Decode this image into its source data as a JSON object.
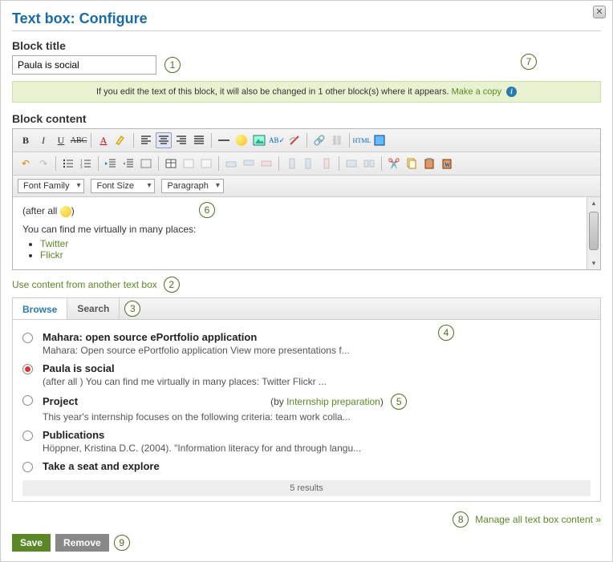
{
  "dialog": {
    "title": "Text box: Configure"
  },
  "block_title": {
    "label": "Block title",
    "value": "Paula is social"
  },
  "notice": {
    "text": "If you edit the text of this block, it will also be changed in 1 other block(s) where it appears.",
    "link": "Make a copy"
  },
  "block_content": {
    "label": "Block content"
  },
  "toolbar": {
    "font_family": "Font Family",
    "font_size": "Font Size",
    "paragraph": "Paragraph"
  },
  "editor": {
    "line1_pre": "(after all ",
    "line1_post": ")",
    "line2": "You can find me virtually in many places:",
    "items": [
      "Twitter",
      "Flickr"
    ]
  },
  "use_other": "Use content from another text box",
  "tabs": {
    "browse": "Browse",
    "search": "Search"
  },
  "results": [
    {
      "title": "Mahara: open source ePortfolio application",
      "desc": "Mahara: Open source ePortfolio application View more presentations f...",
      "selected": false
    },
    {
      "title": "Paula is social",
      "desc": "(after all ) You can find me virtually in many places: Twitter Flickr ...",
      "selected": true
    },
    {
      "title": "Project",
      "desc": "This year's internship focuses on the following criteria: team work colla...",
      "selected": false,
      "by_label": "(by ",
      "by_link": "Internship preparation",
      "by_tail": ")"
    },
    {
      "title": "Publications",
      "desc": "Höppner, Kristina D.C. (2004). \"Information literacy for and through langu...",
      "selected": false
    },
    {
      "title": "Take a seat and explore",
      "desc": "",
      "selected": false
    }
  ],
  "results_footer": "5 results",
  "manage_link": "Manage all text box content »",
  "buttons": {
    "save": "Save",
    "remove": "Remove"
  },
  "callouts": {
    "1": "1",
    "2": "2",
    "3": "3",
    "4": "4",
    "5": "5",
    "6": "6",
    "7": "7",
    "8": "8",
    "9": "9"
  }
}
